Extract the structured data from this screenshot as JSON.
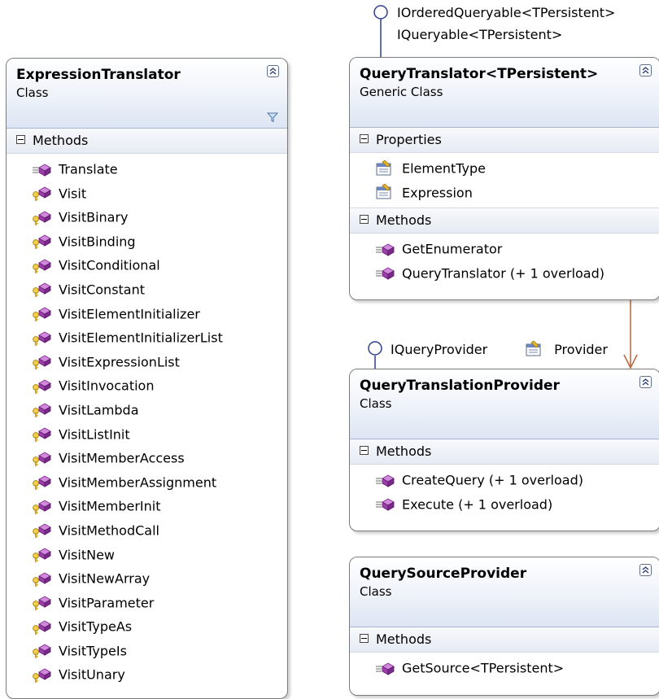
{
  "colors": {
    "border": "#7a7a7a",
    "header_gradient_end": "#dde5f3",
    "interface_line": "#2e3f8f",
    "association_line": "#b5653a",
    "method_icon": "#9b3fa8",
    "protected_key": "#d9b228"
  },
  "shapes": {
    "expression_translator": {
      "title": "ExpressionTranslator",
      "stereotype": "Class",
      "compartments": [
        {
          "name": "Methods",
          "members": [
            {
              "name": "Translate",
              "icon": "public-method-icon"
            },
            {
              "name": "Visit",
              "icon": "protected-method-icon"
            },
            {
              "name": "VisitBinary",
              "icon": "protected-method-icon"
            },
            {
              "name": "VisitBinding",
              "icon": "protected-method-icon"
            },
            {
              "name": "VisitConditional",
              "icon": "protected-method-icon"
            },
            {
              "name": "VisitConstant",
              "icon": "protected-method-icon"
            },
            {
              "name": "VisitElementInitializer",
              "icon": "protected-method-icon"
            },
            {
              "name": "VisitElementInitializerList",
              "icon": "protected-method-icon"
            },
            {
              "name": "VisitExpressionList",
              "icon": "protected-method-icon"
            },
            {
              "name": "VisitInvocation",
              "icon": "protected-method-icon"
            },
            {
              "name": "VisitLambda",
              "icon": "protected-method-icon"
            },
            {
              "name": "VisitListInit",
              "icon": "protected-method-icon"
            },
            {
              "name": "VisitMemberAccess",
              "icon": "protected-method-icon"
            },
            {
              "name": "VisitMemberAssignment",
              "icon": "protected-method-icon"
            },
            {
              "name": "VisitMemberInit",
              "icon": "protected-method-icon"
            },
            {
              "name": "VisitMethodCall",
              "icon": "protected-method-icon"
            },
            {
              "name": "VisitNew",
              "icon": "protected-method-icon"
            },
            {
              "name": "VisitNewArray",
              "icon": "protected-method-icon"
            },
            {
              "name": "VisitParameter",
              "icon": "protected-method-icon"
            },
            {
              "name": "VisitTypeAs",
              "icon": "protected-method-icon"
            },
            {
              "name": "VisitTypeIs",
              "icon": "protected-method-icon"
            },
            {
              "name": "VisitUnary",
              "icon": "protected-method-icon"
            }
          ]
        }
      ]
    },
    "query_translator": {
      "title": "QueryTranslator<TPersistent>",
      "stereotype": "Generic Class",
      "compartments": [
        {
          "name": "Properties",
          "members": [
            {
              "name": "ElementType",
              "icon": "property-icon"
            },
            {
              "name": "Expression",
              "icon": "property-icon"
            }
          ]
        },
        {
          "name": "Methods",
          "members": [
            {
              "name": "GetEnumerator",
              "icon": "public-method-icon"
            },
            {
              "name": "QueryTranslator (+ 1 overload)",
              "icon": "public-method-icon"
            }
          ]
        }
      ],
      "interfaces": [
        "IOrderedQueryable<TPersistent>",
        "IQueryable<TPersistent>"
      ]
    },
    "query_translation_provider": {
      "title": "QueryTranslationProvider",
      "stereotype": "Class",
      "compartments": [
        {
          "name": "Methods",
          "members": [
            {
              "name": "CreateQuery (+ 1 overload)",
              "icon": "public-method-icon"
            },
            {
              "name": "Execute (+ 1 overload)",
              "icon": "public-method-icon"
            }
          ]
        }
      ],
      "interfaces": [
        "IQueryProvider"
      ]
    },
    "query_source_provider": {
      "title": "QuerySourceProvider",
      "stereotype": "Class",
      "compartments": [
        {
          "name": "Methods",
          "members": [
            {
              "name": "GetSource<TPersistent>",
              "icon": "public-method-icon"
            }
          ]
        }
      ]
    }
  },
  "associations": {
    "provider_label": "Provider"
  }
}
